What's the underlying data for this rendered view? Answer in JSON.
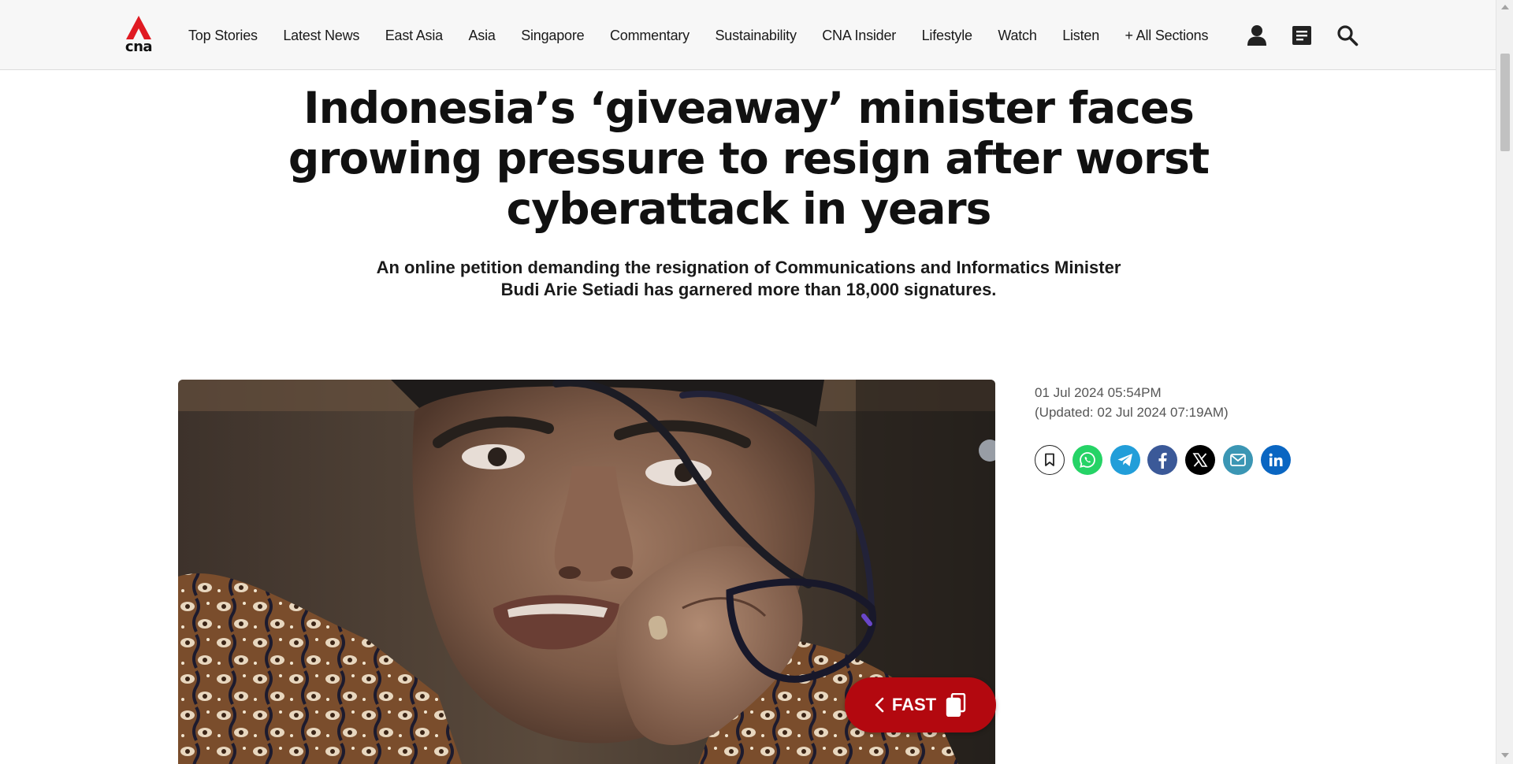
{
  "header": {
    "logo_text": "cna",
    "nav": [
      {
        "label": "Top Stories"
      },
      {
        "label": "Latest News"
      },
      {
        "label": "East Asia"
      },
      {
        "label": "Asia"
      },
      {
        "label": "Singapore"
      },
      {
        "label": "Commentary"
      },
      {
        "label": "Sustainability"
      },
      {
        "label": "CNA Insider"
      },
      {
        "label": "Lifestyle"
      },
      {
        "label": "Watch"
      },
      {
        "label": "Listen"
      },
      {
        "label": "+ All Sections"
      }
    ],
    "icons": [
      "user-icon",
      "document-icon",
      "search-icon"
    ]
  },
  "article": {
    "headline": "Indonesia’s ‘giveaway’ minister faces growing pressure to resign after worst cyberattack in years",
    "standfirst": "An online petition demanding the resignation of Communications and Informatics Minister Budi Arie Setiadi has garnered more than 18,000 signatures.",
    "published": "01 Jul 2024 05:54PM",
    "updated": "(Updated: 02 Jul 2024 07:19AM)"
  },
  "share": [
    {
      "name": "bookmark-icon",
      "color": "#ffffff"
    },
    {
      "name": "whatsapp-icon",
      "color": "#25d366"
    },
    {
      "name": "telegram-icon",
      "color": "#229ed9"
    },
    {
      "name": "facebook-icon",
      "color": "#3b5998"
    },
    {
      "name": "x-icon",
      "color": "#000000"
    },
    {
      "name": "email-icon",
      "color": "#3b96b4"
    },
    {
      "name": "linkedin-icon",
      "color": "#0a66c2"
    }
  ],
  "fast_button": {
    "label": "FAST"
  },
  "colors": {
    "brand_red": "#b3080f",
    "header_bg": "#f7f7f7"
  }
}
